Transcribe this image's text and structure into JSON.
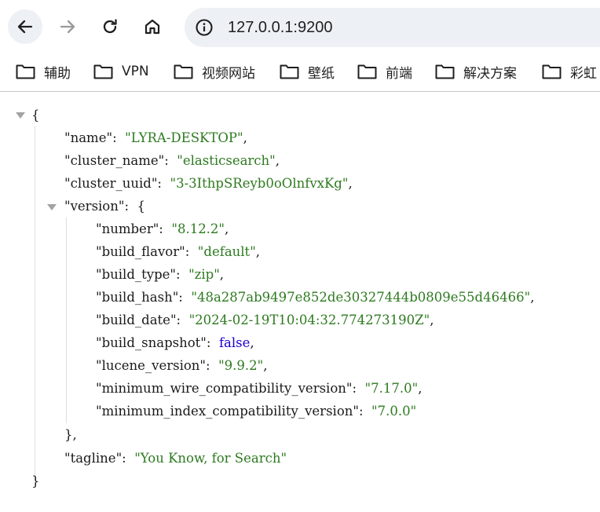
{
  "browser": {
    "url": "127.0.0.1:9200",
    "icons": {
      "back": "arrow-left-icon",
      "forward": "arrow-right-icon",
      "reload": "reload-icon",
      "home": "home-icon",
      "site_info": "info-circle-icon",
      "bookmark_folder": "folder-icon"
    },
    "bookmarks": [
      {
        "label": "辅助"
      },
      {
        "label": "VPN"
      },
      {
        "label": "视频网站"
      },
      {
        "label": "壁纸"
      },
      {
        "label": "前端"
      },
      {
        "label": "解决方案"
      },
      {
        "label": "彩虹"
      }
    ]
  },
  "colors": {
    "string": "#2d7a1f",
    "boolean": "#1c00cf",
    "key": "#1a1a1a",
    "toolbar_button_active": "#edf0f4"
  },
  "json": {
    "open_brace": "{",
    "close_brace": "}",
    "name": {
      "key": "\"name\"",
      "value": "\"LYRA-DESKTOP\""
    },
    "cluster_name": {
      "key": "\"cluster_name\"",
      "value": "\"elasticsearch\""
    },
    "cluster_uuid": {
      "key": "\"cluster_uuid\"",
      "value": "\"3-3IthpSReyb0oOlnfvxKg\""
    },
    "version": {
      "key": "\"version\"",
      "open": "{",
      "close": "},",
      "number": {
        "key": "\"number\"",
        "value": "\"8.12.2\""
      },
      "build_flavor": {
        "key": "\"build_flavor\"",
        "value": "\"default\""
      },
      "build_type": {
        "key": "\"build_type\"",
        "value": "\"zip\""
      },
      "build_hash": {
        "key": "\"build_hash\"",
        "value": "\"48a287ab9497e852de30327444b0809e55d46466\""
      },
      "build_date": {
        "key": "\"build_date\"",
        "value": "\"2024-02-19T10:04:32.774273190Z\""
      },
      "build_snapshot": {
        "key": "\"build_snapshot\"",
        "value": "false"
      },
      "lucene_version": {
        "key": "\"lucene_version\"",
        "value": "\"9.9.2\""
      },
      "minimum_wire_compatibility_version": {
        "key": "\"minimum_wire_compatibility_version\"",
        "value": "\"7.17.0\""
      },
      "minimum_index_compatibility_version": {
        "key": "\"minimum_index_compatibility_version\"",
        "value": "\"7.0.0\""
      }
    },
    "tagline": {
      "key": "\"tagline\"",
      "value": "\"You Know, for Search\""
    }
  }
}
